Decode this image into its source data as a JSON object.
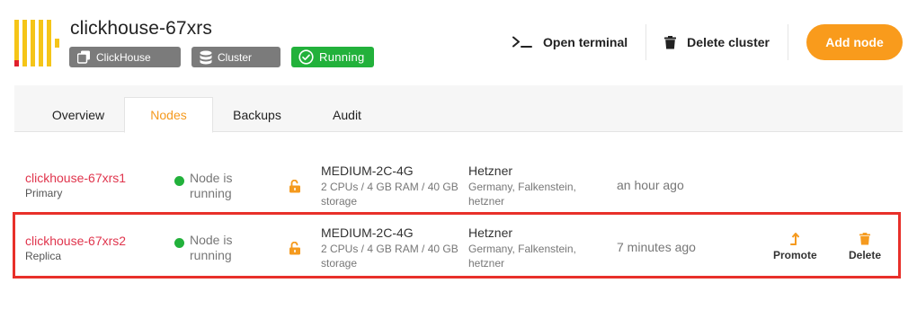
{
  "cluster": {
    "name": "clickhouse-67xrs",
    "tags": [
      {
        "icon": "clickhouse-copy-icon",
        "label": "ClickHouse"
      },
      {
        "icon": "database-icon",
        "label": "Cluster"
      }
    ],
    "status": {
      "icon": "check-circle-icon",
      "label": "Running"
    }
  },
  "actions": {
    "open_terminal": "Open terminal",
    "delete_cluster": "Delete cluster",
    "add_node": "Add node"
  },
  "tabs": [
    {
      "label": "Overview"
    },
    {
      "label": "Nodes",
      "active": true
    },
    {
      "label": "Backups"
    },
    {
      "label": "Audit"
    }
  ],
  "nodes": [
    {
      "name": "clickhouse-67xrs1",
      "role": "Primary",
      "status": "Node is running",
      "lock_icon": "unlock-icon",
      "plan": "MEDIUM-2C-4G",
      "spec": "2 CPUs / 4 GB RAM / 40 GB storage",
      "provider": "Hetzner",
      "location": "Germany, Falkenstein, hetzner",
      "created": "an hour ago"
    },
    {
      "name": "clickhouse-67xrs2",
      "role": "Replica",
      "status": "Node is running",
      "lock_icon": "unlock-icon",
      "plan": "MEDIUM-2C-4G",
      "spec": "2 CPUs / 4 GB RAM / 40 GB storage",
      "provider": "Hetzner",
      "location": "Germany, Falkenstein, hetzner",
      "created": "7 minutes ago",
      "promote_label": "Promote",
      "delete_label": "Delete",
      "selected": true
    }
  ],
  "colors": {
    "accent": "#f99b1c",
    "running": "#22b13b",
    "node_name": "#e0354d",
    "highlight": "#e8302a"
  }
}
